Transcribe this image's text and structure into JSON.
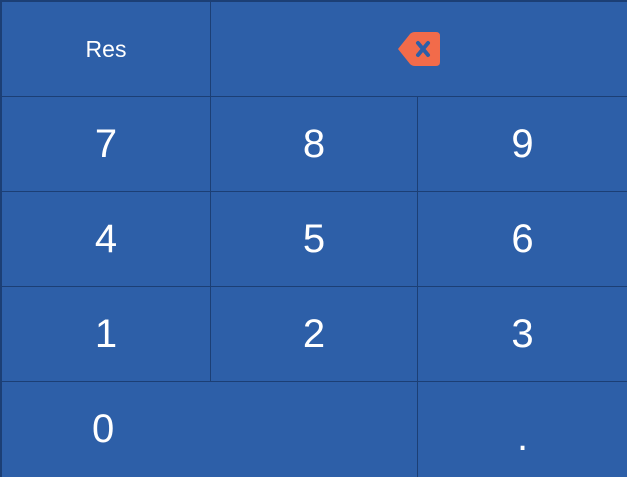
{
  "keypad": {
    "reset_label": "Res",
    "backspace_icon": "backspace-icon",
    "backspace_color": "#f26b4a",
    "background_color": "#2d5fa8",
    "digits": {
      "seven": "7",
      "eight": "8",
      "nine": "9",
      "four": "4",
      "five": "5",
      "six": "6",
      "one": "1",
      "two": "2",
      "three": "3",
      "zero": "0"
    },
    "decimal_label": "."
  }
}
